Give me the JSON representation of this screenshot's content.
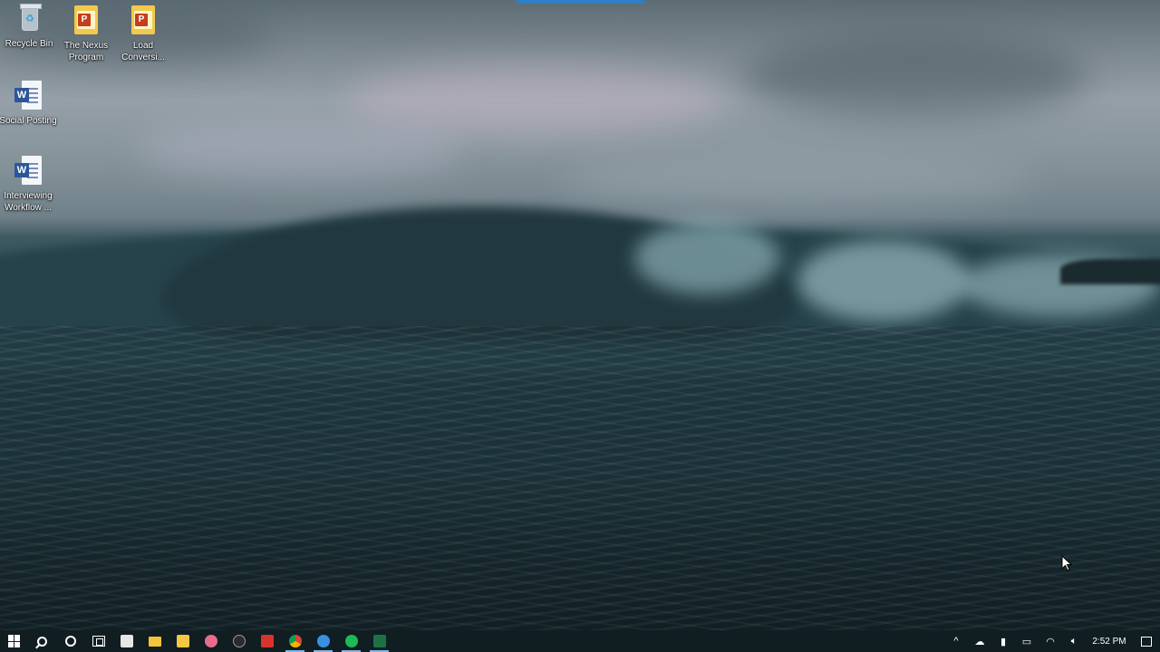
{
  "desktop": {
    "icons": [
      {
        "label": "Recycle Bin",
        "icon": "recycle-bin-icon"
      },
      {
        "label": "The Nexus Program",
        "icon": "powerpoint-file-icon"
      },
      {
        "label": "Load Conversi...",
        "icon": "powerpoint-file-icon"
      },
      {
        "label": "Social Posting",
        "icon": "word-file-icon"
      },
      {
        "label": "Interviewing Workflow ...",
        "icon": "word-file-icon"
      }
    ],
    "ppt_badge": "P",
    "word_badge": "W"
  },
  "taskbar": {
    "apps": [
      {
        "icon": "start-icon"
      },
      {
        "icon": "search-icon"
      },
      {
        "icon": "cortana-icon"
      },
      {
        "icon": "task-view-icon"
      },
      {
        "icon": "notes-app-icon",
        "color": "#e6e6e6"
      },
      {
        "icon": "file-explorer-icon",
        "color": "#f3c33b"
      },
      {
        "icon": "store-icon",
        "color": "#f6c744"
      },
      {
        "icon": "pink-app-icon",
        "color": "#e86d8c"
      },
      {
        "icon": "dark-app-icon",
        "color": "#2b2b2b"
      },
      {
        "icon": "slides-app-icon",
        "color": "#d9342b"
      },
      {
        "icon": "chrome-icon",
        "color": "#4285f4"
      },
      {
        "icon": "network-app-icon",
        "color": "#3b8fe0"
      },
      {
        "icon": "spotify-icon",
        "color": "#1db954"
      },
      {
        "icon": "excel-icon",
        "color": "#1e7145"
      }
    ],
    "tray": {
      "icons": [
        "chevron-up-icon",
        "onedrive-icon",
        "microphone-icon",
        "battery-icon",
        "wifi-icon",
        "volume-icon"
      ],
      "clock": "2:52 PM",
      "notifications_icon": "action-center-icon"
    }
  },
  "colors": {
    "taskbar": "#101e22",
    "accent": "#2f7fc8"
  }
}
